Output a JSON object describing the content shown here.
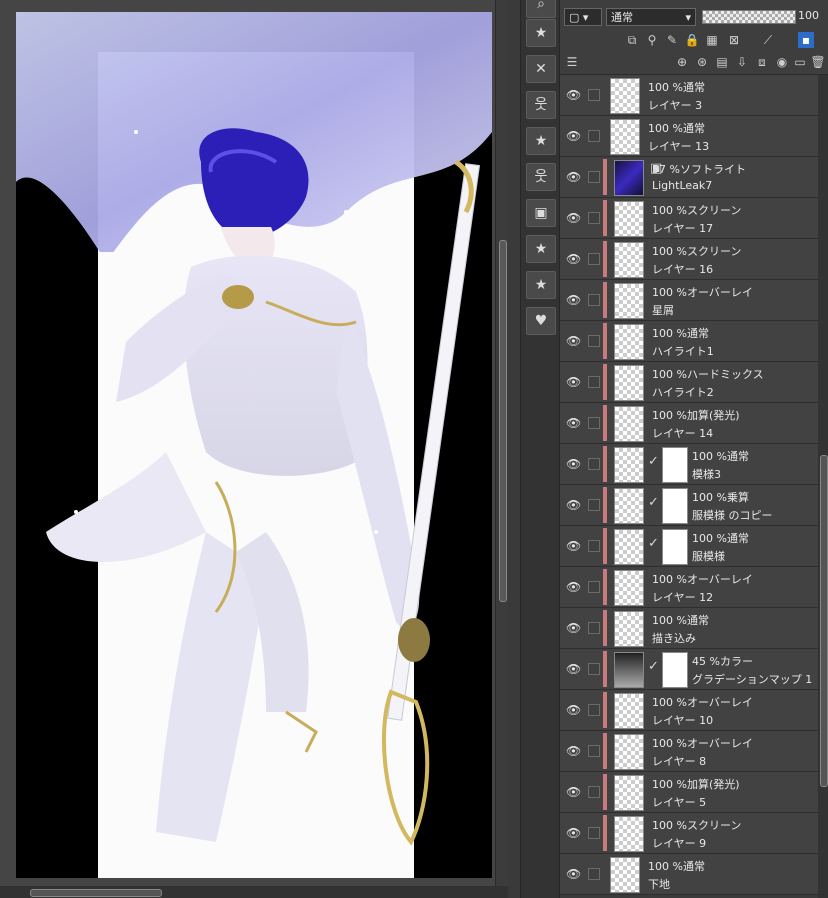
{
  "layer_toolbar": {
    "blend_mode": "通常",
    "opacity_value": "100"
  },
  "layers": [
    {
      "opacity": "100",
      "mode": "%通常",
      "name": "レイヤー 3",
      "clip": false,
      "thumb": "checker"
    },
    {
      "opacity": "100",
      "mode": "%通常",
      "name": "レイヤー 13",
      "clip": false,
      "thumb": "checker"
    },
    {
      "opacity": "57",
      "mode": "%ソフトライト",
      "name": "LightLeak7",
      "clip": true,
      "thumb": "dark"
    },
    {
      "opacity": "100",
      "mode": "%スクリーン",
      "name": "レイヤー 17",
      "clip": true,
      "thumb": "checker"
    },
    {
      "opacity": "100",
      "mode": "%スクリーン",
      "name": "レイヤー 16",
      "clip": true,
      "thumb": "checker"
    },
    {
      "opacity": "100",
      "mode": "%オーバーレイ",
      "name": "星屑",
      "clip": true,
      "thumb": "checker"
    },
    {
      "opacity": "100",
      "mode": "%通常",
      "name": "ハイライト1",
      "clip": true,
      "thumb": "checker"
    },
    {
      "opacity": "100",
      "mode": "%ハードミックス",
      "name": "ハイライト2",
      "clip": true,
      "thumb": "checker"
    },
    {
      "opacity": "100",
      "mode": "%加算(発光)",
      "name": "レイヤー 14",
      "clip": true,
      "thumb": "checker"
    },
    {
      "opacity": "100",
      "mode": "%通常",
      "name": "模様3",
      "clip": true,
      "thumb": "checker",
      "mask": true
    },
    {
      "opacity": "100",
      "mode": "%乗算",
      "name": "服模様 のコピー",
      "clip": true,
      "thumb": "checker",
      "mask": true
    },
    {
      "opacity": "100",
      "mode": "%通常",
      "name": "服模様",
      "clip": true,
      "thumb": "checker",
      "mask": true
    },
    {
      "opacity": "100",
      "mode": "%オーバーレイ",
      "name": "レイヤー 12",
      "clip": true,
      "thumb": "checker"
    },
    {
      "opacity": "100",
      "mode": "%通常",
      "name": "描き込み",
      "clip": true,
      "thumb": "checker"
    },
    {
      "opacity": "45",
      "mode": "%カラー",
      "name": "グラデーションマップ 1",
      "clip": true,
      "thumb": "grad",
      "mask": true
    },
    {
      "opacity": "100",
      "mode": "%オーバーレイ",
      "name": "レイヤー 10",
      "clip": true,
      "thumb": "checker"
    },
    {
      "opacity": "100",
      "mode": "%オーバーレイ",
      "name": "レイヤー 8",
      "clip": true,
      "thumb": "checker"
    },
    {
      "opacity": "100",
      "mode": "%加算(発光)",
      "name": "レイヤー 5",
      "clip": true,
      "thumb": "checker"
    },
    {
      "opacity": "100",
      "mode": "%スクリーン",
      "name": "レイヤー 9",
      "clip": true,
      "thumb": "checker"
    },
    {
      "opacity": "100",
      "mode": "%通常",
      "name": "下地",
      "clip": false,
      "thumb": "checker"
    }
  ],
  "material_icons": [
    "star-folder-icon",
    "x-folder-icon",
    "figure-folder-icon",
    "star-folder-icon",
    "figure-folder-icon",
    "frame-folder-icon",
    "star-folder-icon",
    "star-folder-icon",
    "heart-folder-icon"
  ],
  "colors": {
    "clip_bar": "#c97a7a",
    "panel_bg": "#3b3b3b",
    "row_bg": "#424242"
  }
}
